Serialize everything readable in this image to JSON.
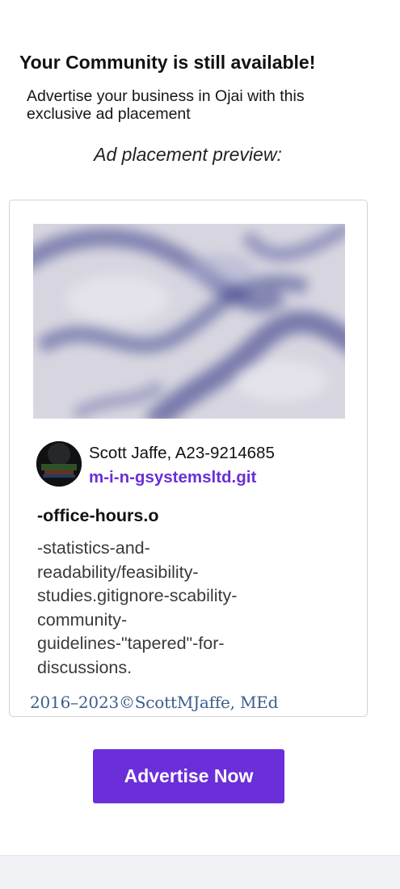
{
  "promo": {
    "headline": "Your Community is still available!",
    "subtitle": "Advertise your business in Ojai with this exclusive ad placement",
    "preview_label": "Ad placement preview:"
  },
  "ad_card": {
    "image": "blurred-photo",
    "author": {
      "avatar": "profile-avatar",
      "name": "Scott Jaffe, A23-9214685",
      "link": "m-i-n-gsystemsltd.git"
    },
    "title": "-office-hours.o",
    "body": "-statistics-and-\nreadability/feasibility-\nstudies.gitignore-scability-\ncommunity-\nguidelines-\"tapered\"-for-\ndiscussions.",
    "copyright": "2016–2023©ScottMJaffe, MEd"
  },
  "cta": {
    "label": "Advertise Now",
    "color": "#6a2fd8"
  },
  "colors": {
    "accent": "#6a2fd8",
    "link": "#6a2fd8",
    "copyright_text": "#3c5e8c",
    "card_border": "#d3d3d3",
    "footer_band": "#f0f2f5"
  }
}
